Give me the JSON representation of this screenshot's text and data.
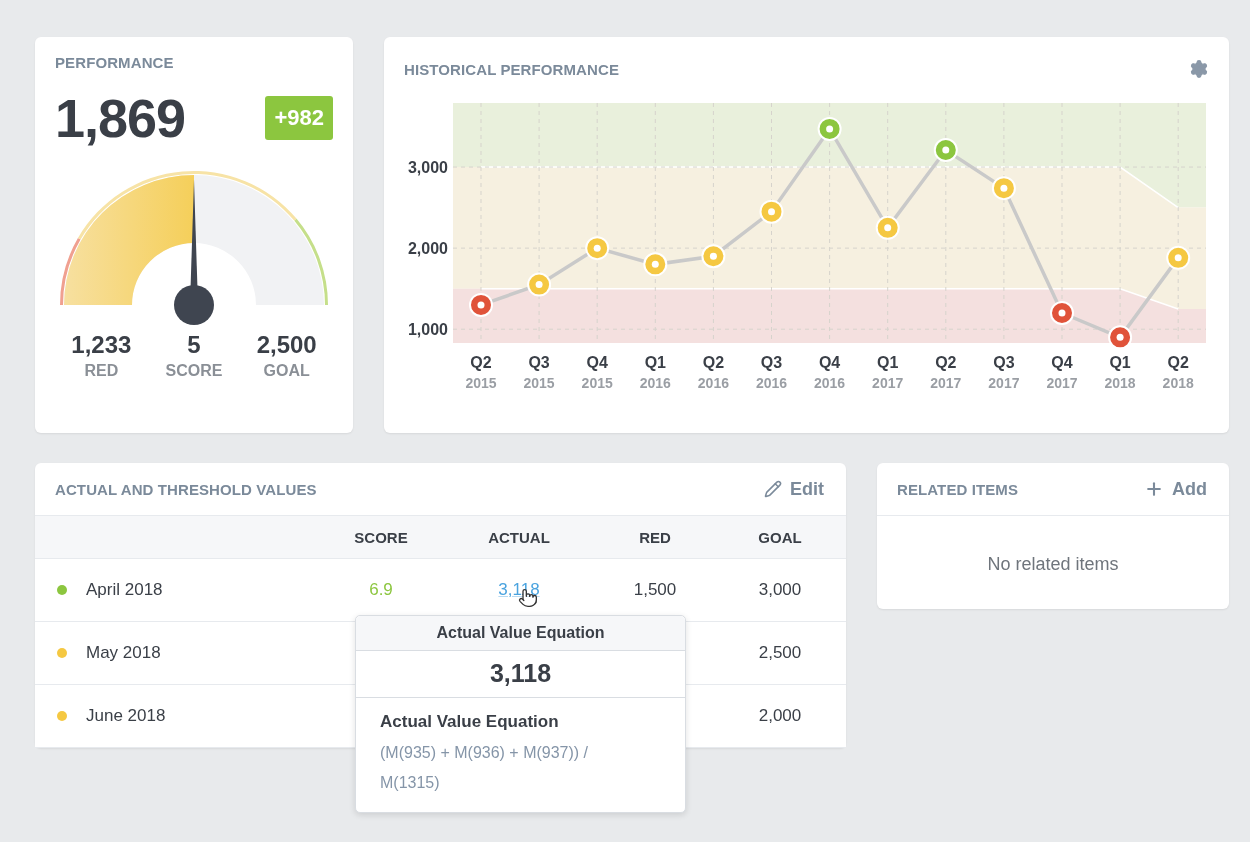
{
  "performance": {
    "title": "PERFORMANCE",
    "value": "1,869",
    "change": "+982",
    "stats": [
      {
        "value": "1,233",
        "label": "RED"
      },
      {
        "value": "5",
        "label": "SCORE"
      },
      {
        "value": "2,500",
        "label": "GOAL"
      }
    ]
  },
  "historical": {
    "title": "HISTORICAL PERFORMANCE",
    "x_sublabels": [
      "2015",
      "2015",
      "2015",
      "2016",
      "2016",
      "2016",
      "2016",
      "2017",
      "2017",
      "2017",
      "2017",
      "2018",
      "2018"
    ],
    "chart_data": {
      "type": "line",
      "grid": true,
      "categories": [
        "Q2",
        "Q3",
        "Q4",
        "Q1",
        "Q2",
        "Q3",
        "Q4",
        "Q1",
        "Q2",
        "Q3",
        "Q4",
        "Q1",
        "Q2"
      ],
      "series": [
        {
          "color": "#c9c9c9",
          "marker": "o",
          "values": [
            1300,
            1550,
            2000,
            1800,
            1900,
            2450,
            3470,
            2250,
            3210,
            2740,
            1200,
            900,
            1880
          ]
        },
        {
          "color": "#ffffff",
          "values": [
            3000,
            3000,
            3000,
            3000,
            3000,
            3000,
            3000,
            3000,
            3000,
            3000,
            3000,
            3000,
            2500
          ]
        },
        {
          "color": "#ffffff",
          "values": [
            1500,
            1500,
            1500,
            1500,
            1500,
            1500,
            1500,
            1500,
            1500,
            1500,
            1500,
            1500,
            1250
          ]
        }
      ],
      "ylim": [
        830,
        3790
      ],
      "yticks": [
        {
          "value": 1000,
          "label": "1,000"
        },
        {
          "value": 2000,
          "label": "2,000"
        },
        {
          "value": 3000,
          "label": "3,000"
        }
      ]
    }
  },
  "table": {
    "title": "ACTUAL AND THRESHOLD VALUES",
    "edit": "Edit",
    "columns": [
      "SCORE",
      "ACTUAL",
      "RED",
      "GOAL"
    ],
    "rows": [
      {
        "name": "April 2018",
        "color": "#8cc63f",
        "score": "6.9",
        "actual": "3,118",
        "red": "1,500",
        "goal": "3,000"
      },
      {
        "name": "May 2018",
        "color": "#f5c842",
        "goal": "2,500"
      },
      {
        "name": "June 2018",
        "color": "#f5c842",
        "goal": "2,000"
      }
    ]
  },
  "tooltip": {
    "title": "Actual Value Equation",
    "value": "3,118",
    "label": "Actual Value Equation",
    "equation": "(M(935) + M(936) + M(937)) / M(1315)"
  },
  "related": {
    "title": "RELATED ITEMS",
    "add": "Add",
    "empty": "No related items"
  }
}
